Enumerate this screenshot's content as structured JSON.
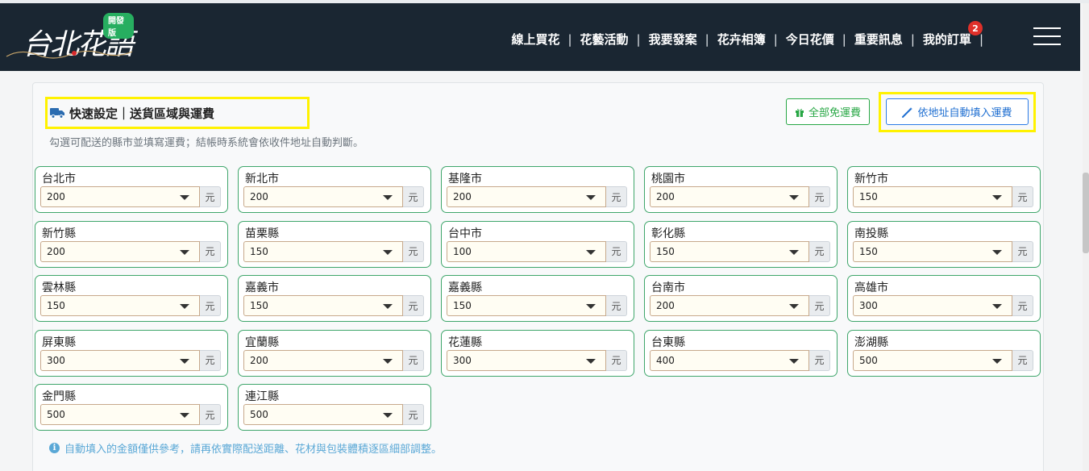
{
  "header": {
    "logo_text": "台北花語",
    "logo_badge": "開發版",
    "nav": [
      {
        "label": "線上買花"
      },
      {
        "label": "花藝活動"
      },
      {
        "label": "我要發案"
      },
      {
        "label": "花卉相簿"
      },
      {
        "label": "今日花價"
      },
      {
        "label": "重要訊息"
      },
      {
        "label": "我的訂單",
        "badge": "2"
      }
    ],
    "separator": "|"
  },
  "card": {
    "title": "快速設定｜送貨區域與運費",
    "title_icon": "truck-icon",
    "hint": "勾選可配送的縣市並填寫運費；結帳時系統會依收件地址自動判斷。",
    "btn_free": "全部免運費",
    "btn_free_icon": "gift-icon",
    "btn_auto": "依地址自動填入運費",
    "btn_auto_icon": "magic-wand-icon",
    "unit": "元",
    "regions": [
      {
        "name": "台北市",
        "fee": "200"
      },
      {
        "name": "新北市",
        "fee": "200"
      },
      {
        "name": "基隆市",
        "fee": "200"
      },
      {
        "name": "桃園市",
        "fee": "200"
      },
      {
        "name": "新竹市",
        "fee": "150"
      },
      {
        "name": "新竹縣",
        "fee": "200"
      },
      {
        "name": "苗栗縣",
        "fee": "150"
      },
      {
        "name": "台中市",
        "fee": "100"
      },
      {
        "name": "彰化縣",
        "fee": "150"
      },
      {
        "name": "南投縣",
        "fee": "150"
      },
      {
        "name": "雲林縣",
        "fee": "150"
      },
      {
        "name": "嘉義市",
        "fee": "150"
      },
      {
        "name": "嘉義縣",
        "fee": "150"
      },
      {
        "name": "台南市",
        "fee": "200"
      },
      {
        "name": "高雄市",
        "fee": "300"
      },
      {
        "name": "屏東縣",
        "fee": "300"
      },
      {
        "name": "宜蘭縣",
        "fee": "200"
      },
      {
        "name": "花蓮縣",
        "fee": "300"
      },
      {
        "name": "台東縣",
        "fee": "400"
      },
      {
        "name": "澎湖縣",
        "fee": "500"
      },
      {
        "name": "金門縣",
        "fee": "500"
      },
      {
        "name": "連江縣",
        "fee": "500"
      }
    ],
    "footnote": "自動填入的金額僅供參考，請再依實際配送距離、花材與包裝體積逐區細部調整。",
    "footnote_icon": "info-icon"
  },
  "colors": {
    "header_bg": "#1a2632",
    "highlight": "#fff200",
    "region_border": "#3fa66b",
    "free_green": "#28a745",
    "auto_blue": "#1f6fd1"
  }
}
